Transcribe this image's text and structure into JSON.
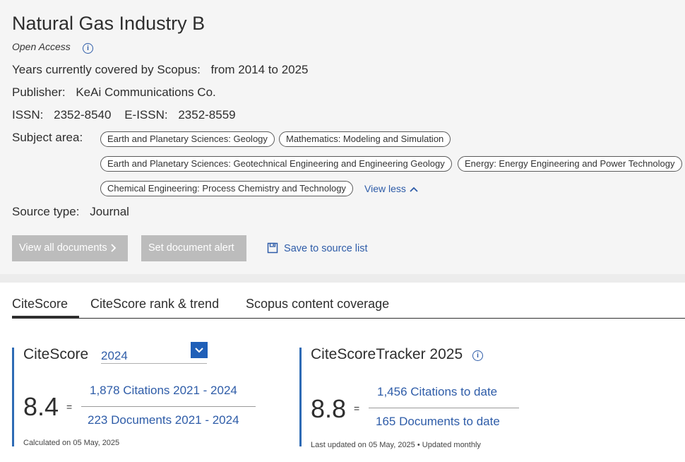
{
  "source": {
    "title": "Natural Gas Industry B",
    "access": "Open Access",
    "years_label": "Years currently covered by Scopus:",
    "years_value": "from 2014 to 2025",
    "publisher_label": "Publisher:",
    "publisher_value": "KeAi Communications Co.",
    "issn_label": "ISSN:",
    "issn_value": "2352-8540",
    "eissn_label": "E-ISSN:",
    "eissn_value": "2352-8559",
    "subject_label": "Subject area:",
    "subjects": [
      "Earth and Planetary Sciences: Geology",
      "Mathematics: Modeling and Simulation",
      "Earth and Planetary Sciences: Geotechnical Engineering and Engineering Geology",
      "Energy: Energy Engineering and Power Technology",
      "Chemical Engineering: Process Chemistry and Technology"
    ],
    "view_less": "View less",
    "source_type_label": "Source type:",
    "source_type_value": "Journal"
  },
  "actions": {
    "view_all": "View all documents",
    "set_alert": "Set document alert",
    "save_list": "Save to source list"
  },
  "tabs": [
    "CiteScore",
    "CiteScore rank & trend",
    "Scopus content coverage"
  ],
  "citescore": {
    "heading": "CiteScore",
    "year": "2024",
    "value": "8.4",
    "equals": "=",
    "numerator": "1,878 Citations 2021 - 2024",
    "denominator": "223 Documents 2021 - 2024",
    "calculated": "Calculated on 05 May, 2025"
  },
  "tracker": {
    "heading": "CiteScoreTracker 2025",
    "value": "8.8",
    "equals": "=",
    "numerator": "1,456 Citations to date",
    "denominator": "165 Documents to date",
    "updated": "Last updated on 05 May, 2025 • Updated monthly"
  },
  "colors": {
    "link": "#2e5ca8",
    "accent": "#2e6bb5",
    "button_disabled": "#bcbcbc"
  }
}
